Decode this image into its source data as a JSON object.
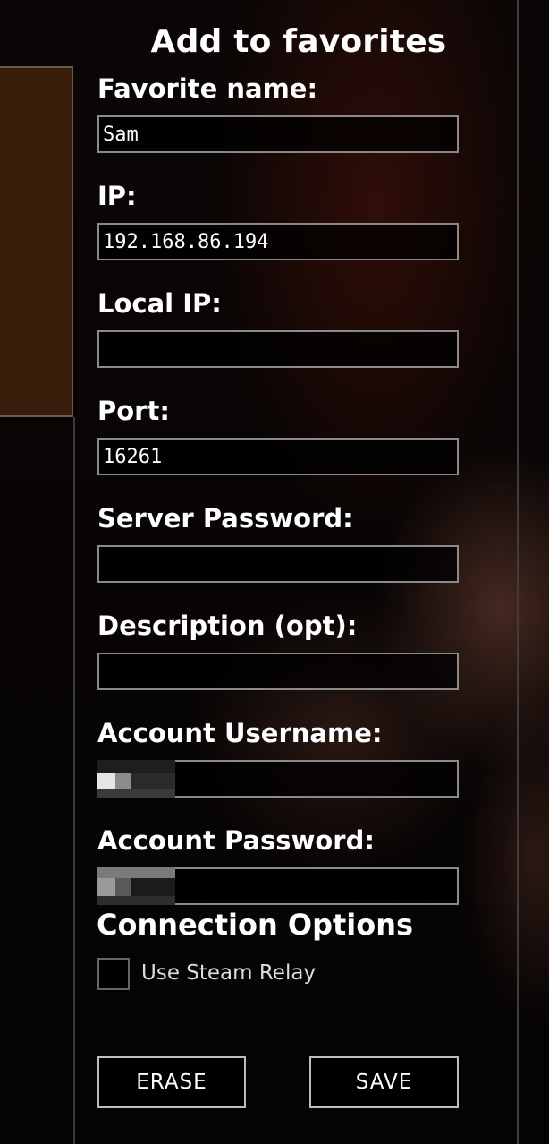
{
  "dialog": {
    "title": "Add to favorites"
  },
  "fields": [
    {
      "label": "Favorite name:",
      "value": "Sam"
    },
    {
      "label": "IP:",
      "value": "192.168.86.194"
    },
    {
      "label": "Local IP:",
      "value": ""
    },
    {
      "label": "Port:",
      "value": "16261"
    },
    {
      "label": "Server Password:",
      "value": ""
    },
    {
      "label": "Description (opt):",
      "value": ""
    },
    {
      "label": "Account Username:",
      "value": ""
    },
    {
      "label": "Account Password:",
      "value": ""
    }
  ],
  "connection": {
    "heading": "Connection Options",
    "steam_relay_label": "Use Steam Relay",
    "steam_relay_checked": false
  },
  "buttons": {
    "erase": "ERASE",
    "save": "SAVE"
  }
}
